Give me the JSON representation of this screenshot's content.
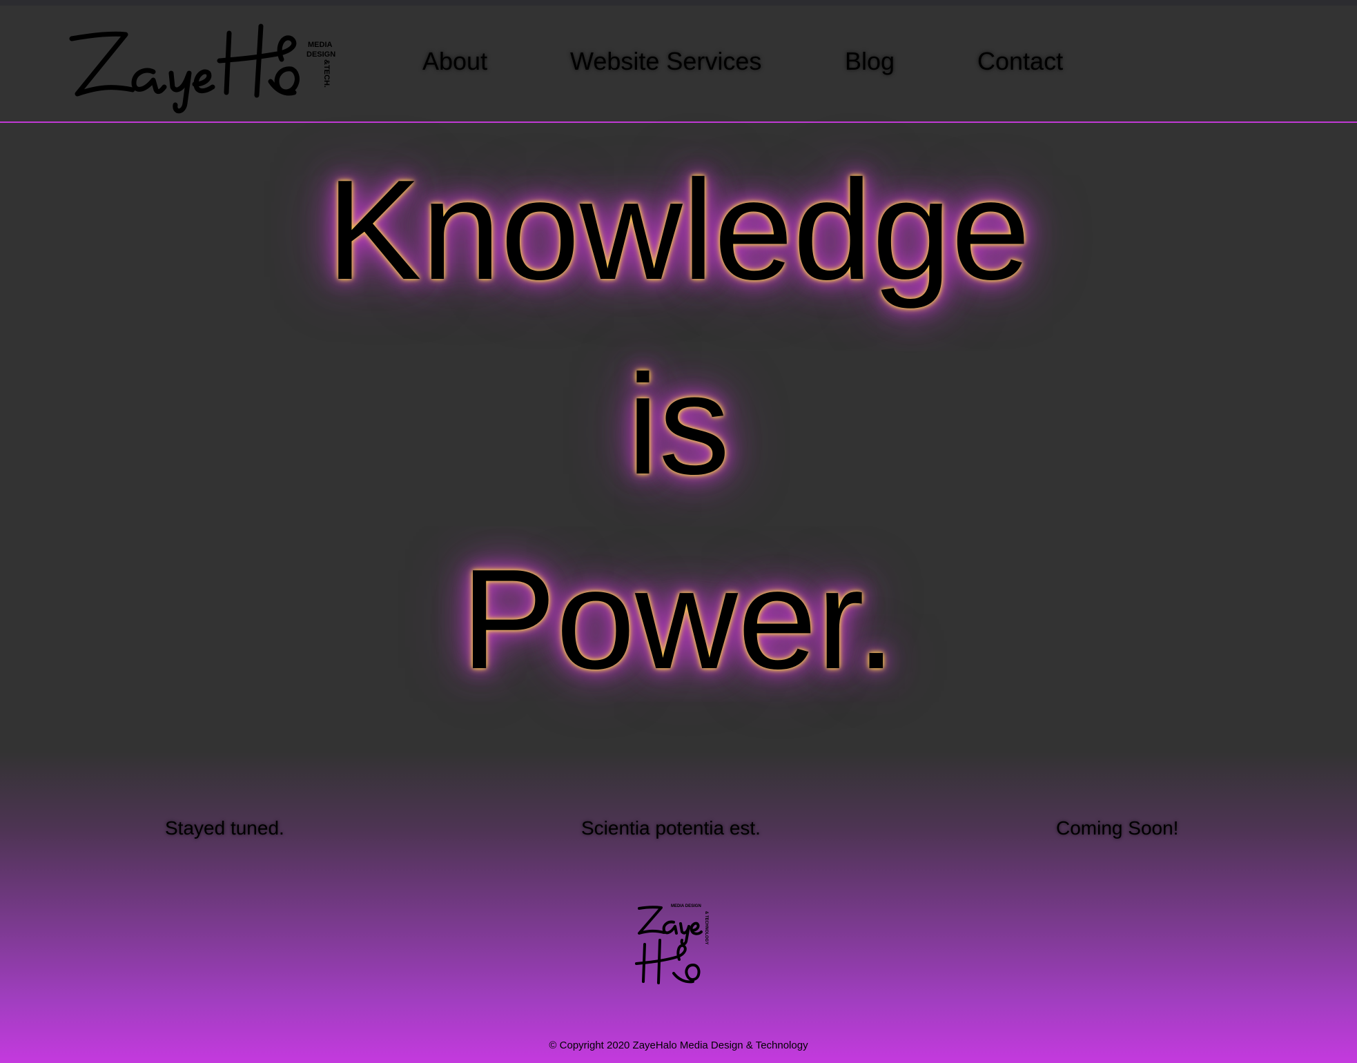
{
  "brand": {
    "logo_text": "ZayeHalo",
    "logo_sub": [
      "MEDIA",
      "DESIGN",
      "&TECH."
    ],
    "footer_logo_text_top": "Zaye",
    "footer_logo_text_bottom": "Halo",
    "footer_logo_sub_top": "MEDIA DESIGN",
    "footer_logo_sub_side": "& TECHNOLOGY"
  },
  "nav": {
    "items": [
      {
        "label": "About"
      },
      {
        "label": "Website Services"
      },
      {
        "label": "Blog"
      },
      {
        "label": "Contact"
      }
    ]
  },
  "hero": {
    "line1": "Knowledge",
    "line2": "is",
    "line3": "Power."
  },
  "taglines": [
    {
      "text": "Stayed tuned."
    },
    {
      "text": "Scientia potentia est."
    },
    {
      "text": "Coming Soon!"
    }
  ],
  "footer": {
    "copyright": "© Copyright 2020 ZayeHalo Media Design & Technology"
  },
  "colors": {
    "background": "#333333",
    "accent_purple": "#c23ad6",
    "glow_yellow": "#f4c64a",
    "text": "#000000"
  }
}
